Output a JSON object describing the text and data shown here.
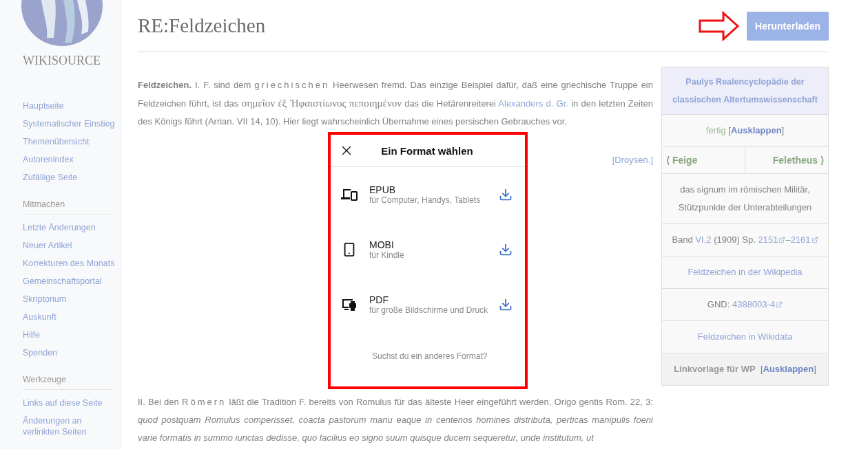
{
  "sidebar": {
    "logo_text": "WIKISOURCE",
    "sections": [
      {
        "items": [
          "Hauptseite",
          "Systematischer Einstieg",
          "Themenübersicht",
          "Autorenindex",
          "Zufällige Seite"
        ]
      },
      {
        "heading": "Mitmachen",
        "items": [
          "Letzte Änderungen",
          "Neuer Artikel",
          "Korrekturen des Monats",
          "Gemeinschaftsportal",
          "Skriptorium",
          "Auskunft",
          "Hilfe",
          "Spenden"
        ]
      },
      {
        "heading": "Werkzeuge",
        "items": [
          "Links auf diese Seite",
          "Änderungen an verlinkten Seiten"
        ]
      }
    ]
  },
  "page": {
    "title": "RE:Feldzeichen",
    "download_button": "Herunterladen",
    "paragraphs": [
      {
        "segments": [
          {
            "kind": "bold",
            "text": "Feldzeichen."
          },
          {
            "kind": "text",
            "text": " I. F. sind dem "
          },
          {
            "kind": "spaced",
            "text": "griechischen"
          },
          {
            "kind": "text",
            "text": " Heerwesen fremd. Das einzige Beispiel dafür, daß eine griechische Truppe ein Feldzeichen führt, ist das "
          },
          {
            "kind": "greek",
            "text": "σημεῖον ἐξ Ἡφαιστίωνος πεποιημένον"
          },
          {
            "kind": "text",
            "text": " das die Hetärenreiterei "
          },
          {
            "kind": "link",
            "text": "Alexanders d. Gr."
          },
          {
            "kind": "text",
            "text": " in den letzten Zeiten des Königs führt (Arrian. VII 14, 10). Hier liegt wahrscheinlich Übernahme eines persischen Gebrauches vor."
          }
        ]
      },
      {
        "segments": [
          {
            "kind": "text",
            "text": "II. Bei den "
          },
          {
            "kind": "spaced",
            "text": "Römern"
          },
          {
            "kind": "text",
            "text": " läßt die Tradition F. bereits von Romulus für das älteste Heer eingeführt werden, Origo gentis Rom. 22, 3: "
          },
          {
            "kind": "italic",
            "text": "quod postquam Romulus comperisset, coacta pastorum manu eaque in centenos homines distributa, perticas manipulis foeni varie formatis in summo iunctas dedisse, quo facilius eo signo suum quisque ducem sequeretur, unde institutum, ut"
          }
        ]
      }
    ],
    "signature": "[Droysen.]",
    "infobox": [
      {
        "kind": "header",
        "text": "Paulys Realencyclopädie der classischen Altertumswissenschaft"
      },
      {
        "kind": "segments",
        "segments": [
          {
            "kind": "status",
            "text": "fertig"
          },
          {
            "kind": "text",
            "text": " ["
          },
          {
            "kind": "bold_link",
            "text": "Ausklappen"
          },
          {
            "kind": "text",
            "text": "]"
          }
        ]
      },
      {
        "kind": "nav",
        "prev": "⟨ Feige",
        "next": "Feletheus ⟩"
      },
      {
        "kind": "segments",
        "segments": [
          {
            "kind": "text",
            "text": "das signum im römischen Militär, Stützpunkte der Unterabteilungen"
          }
        ]
      },
      {
        "kind": "segments",
        "segments": [
          {
            "kind": "text",
            "text": "Band "
          },
          {
            "kind": "link",
            "text": "VI,2"
          },
          {
            "kind": "text",
            "text": " (1909) Sp. "
          },
          {
            "kind": "external",
            "text": "2151"
          },
          {
            "kind": "text",
            "text": "–"
          },
          {
            "kind": "external",
            "text": "2161"
          }
        ]
      },
      {
        "kind": "segments",
        "segments": [
          {
            "kind": "link",
            "text": "Feldzeichen in der Wikipedia"
          }
        ]
      },
      {
        "kind": "segments",
        "segments": [
          {
            "kind": "text",
            "text": "GND: "
          },
          {
            "kind": "external",
            "text": "4388003-4"
          }
        ]
      },
      {
        "kind": "segments",
        "segments": [
          {
            "kind": "link",
            "text": "Feldzeichen in Wikidata"
          }
        ]
      },
      {
        "kind": "footer",
        "segments": [
          {
            "kind": "bold",
            "text": "Linkvorlage für WP"
          },
          {
            "kind": "text",
            "text": "  ["
          },
          {
            "kind": "bold_link",
            "text": "Ausklappen"
          },
          {
            "kind": "text",
            "text": "]"
          }
        ]
      }
    ]
  },
  "dialog": {
    "title": "Ein Format wählen",
    "formats": [
      {
        "kind": "devices",
        "name": "EPUB",
        "description": "für Computer, Handys, Tablets"
      },
      {
        "kind": "phone",
        "name": "MOBI",
        "description": "für Kindle"
      },
      {
        "kind": "print",
        "name": "PDF",
        "description": "für große Bildschirme und Druck"
      }
    ],
    "footer": "Suchst du ein anderes Format?"
  }
}
